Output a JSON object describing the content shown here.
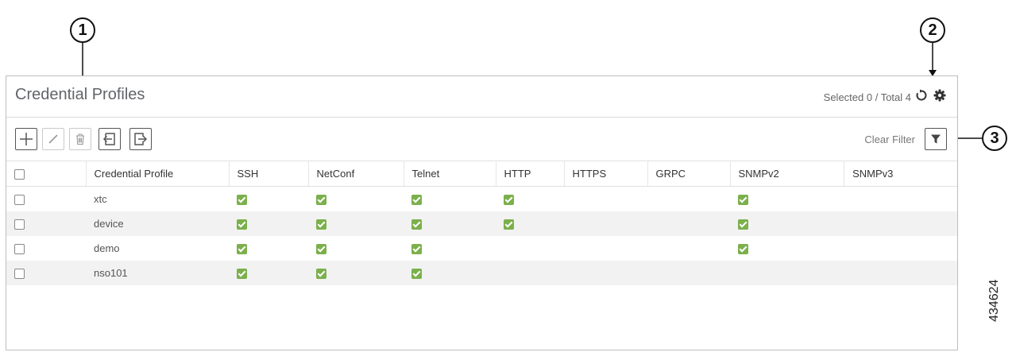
{
  "callouts": [
    "1",
    "2",
    "3"
  ],
  "header": {
    "title": "Credential Profiles",
    "selection_status": "Selected 0 / Total 4"
  },
  "toolbar": {
    "buttons": [
      {
        "icon": "plus-icon",
        "enabled": true
      },
      {
        "icon": "pencil-icon",
        "enabled": false
      },
      {
        "icon": "trash-icon",
        "enabled": false
      },
      {
        "icon": "import-icon",
        "enabled": true
      },
      {
        "icon": "export-icon",
        "enabled": true
      }
    ],
    "clear_filter": "Clear Filter"
  },
  "table": {
    "columns": [
      "Credential Profile",
      "SSH",
      "NetConf",
      "Telnet",
      "HTTP",
      "HTTPS",
      "GRPC",
      "SNMPv2",
      "SNMPv3"
    ],
    "rows": [
      {
        "name": "xtc",
        "ssh": true,
        "netconf": true,
        "telnet": true,
        "http": true,
        "https": false,
        "grpc": false,
        "snmpv2": true,
        "snmpv3": false
      },
      {
        "name": "device",
        "ssh": true,
        "netconf": true,
        "telnet": true,
        "http": true,
        "https": false,
        "grpc": false,
        "snmpv2": true,
        "snmpv3": false
      },
      {
        "name": "demo",
        "ssh": true,
        "netconf": true,
        "telnet": true,
        "http": false,
        "https": false,
        "grpc": false,
        "snmpv2": true,
        "snmpv3": false
      },
      {
        "name": "nso101",
        "ssh": true,
        "netconf": true,
        "telnet": true,
        "http": false,
        "https": false,
        "grpc": false,
        "snmpv2": false,
        "snmpv3": false
      }
    ]
  },
  "figure_id": "434624",
  "colors": {
    "check_green": "#7bb04c",
    "border": "#bdbdbd",
    "alt_row": "#f2f2f2"
  }
}
